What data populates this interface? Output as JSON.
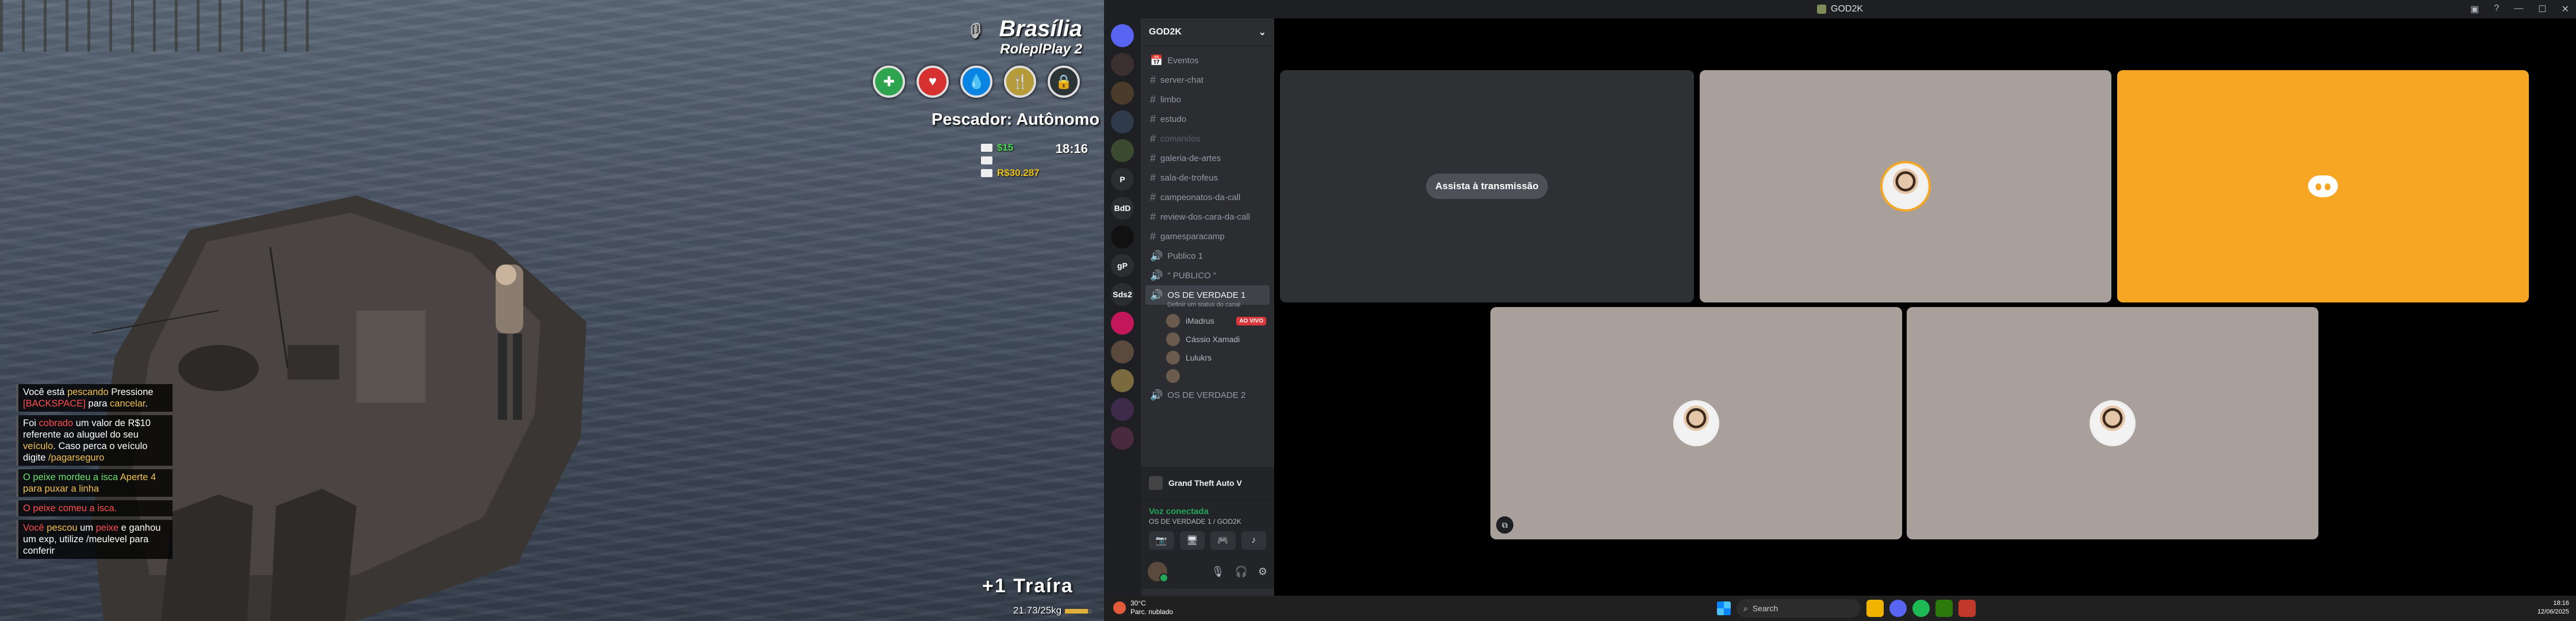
{
  "game": {
    "hud": {
      "city": "Brasília",
      "server": "RoleplPlay 2",
      "status_icons": [
        {
          "name": "stamina-icon",
          "color": "#2ea44f",
          "glyph": "✚"
        },
        {
          "name": "health-icon",
          "color": "#d63031",
          "glyph": "♥"
        },
        {
          "name": "water-icon",
          "color": "#0984e3",
          "glyph": "💧"
        },
        {
          "name": "food-icon",
          "color": "#b59b3a",
          "glyph": "🍴"
        },
        {
          "name": "armor-icon",
          "color": "#2d3436",
          "glyph": "🔒"
        }
      ],
      "job": "Pescador: Autônomo",
      "cash_value": "$15",
      "bank_value": "R$30.287",
      "clock": "18:16"
    },
    "chat": [
      {
        "parts": [
          {
            "t": "Você está "
          },
          {
            "t": "pescando",
            "c": "y"
          },
          {
            "t": " Pressione "
          },
          {
            "t": "[BACKSPACE]",
            "c": "r"
          },
          {
            "t": " para "
          },
          {
            "t": "cancelar",
            "c": "y"
          },
          {
            "t": "."
          }
        ]
      },
      {
        "parts": [
          {
            "t": "Foi "
          },
          {
            "t": "cobrado",
            "c": "r"
          },
          {
            "t": " um valor de R$10 referente ao aluguel do seu "
          },
          {
            "t": "veículo",
            "c": "y"
          },
          {
            "t": ". Caso perca o veículo digite "
          },
          {
            "t": "/pagarseguro",
            "c": "y"
          }
        ]
      },
      {
        "parts": [
          {
            "t": "O peixe mordeu a isca",
            "c": "g"
          },
          {
            "t": " Aperte 4 para puxar a linha",
            "c": "y"
          }
        ]
      },
      {
        "parts": [
          {
            "t": "O peixe comeu a isca.",
            "c": "r"
          }
        ]
      },
      {
        "parts": [
          {
            "t": "Você ",
            "c": "r"
          },
          {
            "t": "pescou",
            "c": "y"
          },
          {
            "t": " um "
          },
          {
            "t": "peixe",
            "c": "r"
          },
          {
            "t": " e ganhou um exp, utilize /meulevel para conferir"
          }
        ]
      }
    ],
    "catch_text": "+1 Traíra",
    "weight_text": "21.73/25kg",
    "weight_fraction": 0.87
  },
  "discord": {
    "window_title": "GOD2K",
    "server_name": "GOD2K",
    "servers": [
      "",
      "",
      "",
      "",
      "",
      "P",
      "BdD",
      "",
      "gP",
      "Sds2",
      "",
      "",
      "",
      "",
      ""
    ],
    "channels": [
      {
        "type": "event",
        "label": "Eventos"
      },
      {
        "type": "text",
        "label": "server-chat"
      },
      {
        "type": "text",
        "label": "limbo"
      },
      {
        "type": "text",
        "label": "estudo"
      },
      {
        "type": "text",
        "label": "comandos",
        "muted": true
      },
      {
        "type": "text",
        "label": "galeria-de-artes"
      },
      {
        "type": "text",
        "label": "sala-de-trofeus"
      },
      {
        "type": "text",
        "label": "campeonatos-da-call"
      },
      {
        "type": "text",
        "label": "review-dos-cara-da-call"
      },
      {
        "type": "text",
        "label": "gamesparacamp"
      },
      {
        "type": "voice",
        "label": "Publico 1"
      },
      {
        "type": "voice",
        "label": "\" PUBLICO \""
      }
    ],
    "active_voice": {
      "label": "OS DE VERDADE 1",
      "status": "Definir um status do canal",
      "users": [
        {
          "name": "iMadrus",
          "live": "AO VIVO"
        },
        {
          "name": "Cássio Xamadi"
        },
        {
          "name": "Lulukrs"
        },
        {
          "name": ""
        }
      ]
    },
    "other_voice": "OS DE VERDADE 2",
    "activity": "Grand Theft Auto V",
    "voice_connected": "Voz conectada",
    "voice_channel_path": "OS DE VERDADE 1 / GOD2K",
    "stream_button": "Assista à transmissão",
    "colors": {
      "accent_orange": "#f6a623",
      "connected_green": "#23a55a",
      "live_red": "#da373c"
    }
  },
  "taskbar": {
    "temp": "30°C",
    "weather": "Parc. nublado",
    "search_placeholder": "Search",
    "time": "18:16",
    "date": "12/06/2025"
  }
}
